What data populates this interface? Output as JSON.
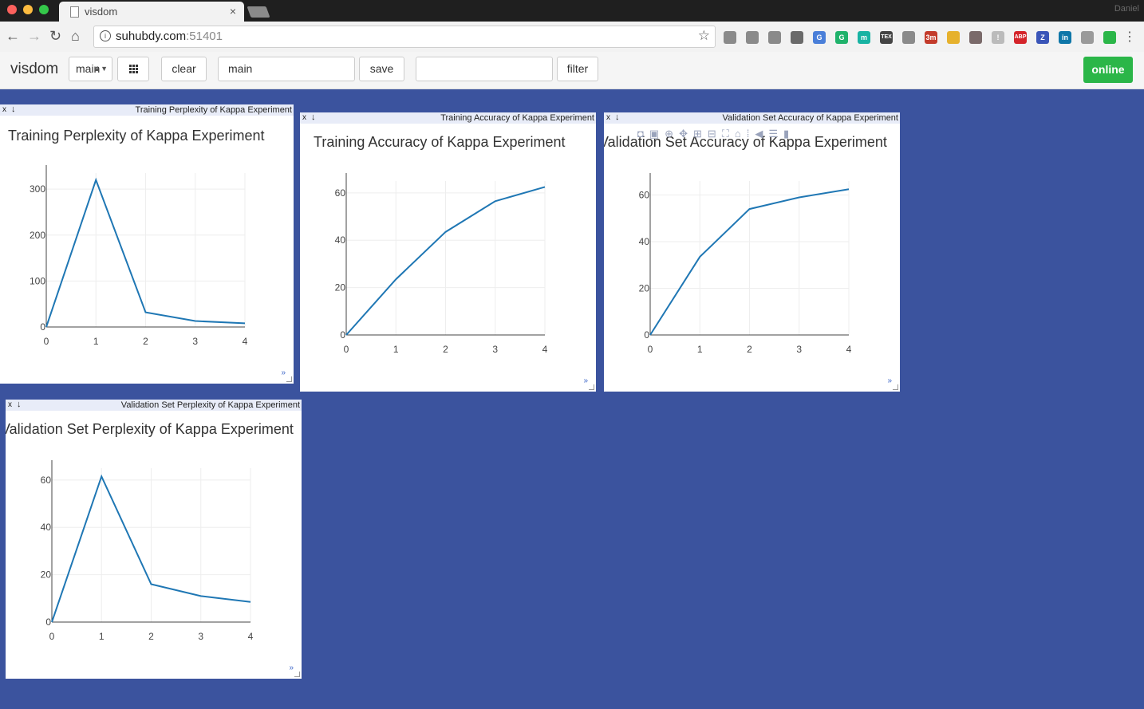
{
  "browser": {
    "tab_title": "visdom",
    "tab_close": "×",
    "profile_name": "Daniel",
    "url_host": "suhubdy.com",
    "url_port": ":51401",
    "menu_icon": "⋮"
  },
  "extensions": [
    {
      "name": "docs-icon",
      "color": "#8a8a8a",
      "text": ""
    },
    {
      "name": "drive-icon",
      "color": "#8a8a8a",
      "text": ""
    },
    {
      "name": "pocket-icon",
      "color": "#8a8a8a",
      "text": ""
    },
    {
      "name": "dropbox-icon",
      "color": "#6a6a6a",
      "text": ""
    },
    {
      "name": "translate-icon",
      "color": "#4a7fd9",
      "text": "G"
    },
    {
      "name": "grammarly-icon",
      "color": "#20b26b",
      "text": "G"
    },
    {
      "name": "mendeley-icon",
      "color": "#18b3a3",
      "text": "m"
    },
    {
      "name": "tex-icon",
      "color": "#444444",
      "text": "TEX"
    },
    {
      "name": "note-icon",
      "color": "#8a8a8a",
      "text": ""
    },
    {
      "name": "timer-icon",
      "color": "#c33b2b",
      "text": "3m"
    },
    {
      "name": "emoji-icon",
      "color": "#e6b12d",
      "text": ""
    },
    {
      "name": "avatar-icon",
      "color": "#7a6a6a",
      "text": ""
    },
    {
      "name": "alert-icon",
      "color": "#bbbbbb",
      "text": "!"
    },
    {
      "name": "adblock-icon",
      "color": "#d4242a",
      "text": "ABP"
    },
    {
      "name": "zotero-icon",
      "color": "#3a55b8",
      "text": "Z"
    },
    {
      "name": "linkedin-icon",
      "color": "#0e76a8",
      "text": "in"
    },
    {
      "name": "settings-ext-icon",
      "color": "#9a9a9a",
      "text": ""
    },
    {
      "name": "shield-ext-icon",
      "color": "#2bb648",
      "text": ""
    }
  ],
  "toolbar": {
    "brand": "visdom",
    "env_select": "main",
    "clear_label": "clear",
    "env_name_value": "main",
    "save_label": "save",
    "filter_value": "",
    "filter_label": "filter",
    "status_label": "online"
  },
  "panes": [
    {
      "window_title": "Training Perplexity of Kappa Experiment",
      "plot_title": "Training Perplexity of Kappa Experiment",
      "chart_data": {
        "type": "line",
        "x": [
          0,
          1,
          2,
          3,
          4
        ],
        "y": [
          0,
          320,
          32,
          13,
          8
        ],
        "xlim": [
          0,
          4
        ],
        "ylim": [
          0,
          335
        ],
        "yticks": [
          0,
          100,
          200,
          300
        ],
        "xticks": [
          0,
          1,
          2,
          3,
          4
        ],
        "grid": true,
        "color": "#1f77b4"
      }
    },
    {
      "window_title": "Training Accuracy of Kappa Experiment",
      "plot_title": "Training Accuracy of Kappa Experiment",
      "chart_data": {
        "type": "line",
        "x": [
          0,
          1,
          2,
          3,
          4
        ],
        "y": [
          0,
          23.5,
          43.5,
          56.5,
          62.5
        ],
        "xlim": [
          0,
          4
        ],
        "ylim": [
          0,
          65
        ],
        "yticks": [
          0,
          20,
          40,
          60
        ],
        "xticks": [
          0,
          1,
          2,
          3,
          4
        ],
        "grid": true,
        "color": "#1f77b4"
      }
    },
    {
      "window_title": "Validation Set Accuracy of Kappa Experiment",
      "plot_title": "Validation Set Accuracy of Kappa Experiment",
      "chart_data": {
        "type": "line",
        "x": [
          0,
          1,
          2,
          3,
          4
        ],
        "y": [
          0,
          33.5,
          54,
          59,
          62.5
        ],
        "xlim": [
          0,
          4
        ],
        "ylim": [
          0,
          66
        ],
        "yticks": [
          0,
          20,
          40,
          60
        ],
        "xticks": [
          0,
          1,
          2,
          3,
          4
        ],
        "grid": true,
        "color": "#1f77b4"
      }
    },
    {
      "window_title": "Validation Set Perplexity of Kappa Experiment",
      "plot_title": "Validation Set Perplexity of Kappa Experiment",
      "chart_data": {
        "type": "line",
        "x": [
          0,
          1,
          2,
          3,
          4
        ],
        "y": [
          0,
          61.5,
          16,
          11,
          8.5
        ],
        "xlim": [
          0,
          4
        ],
        "ylim": [
          0,
          65
        ],
        "yticks": [
          0,
          20,
          40,
          60
        ],
        "xticks": [
          0,
          1,
          2,
          3,
          4
        ],
        "grid": true,
        "color": "#1f77b4"
      }
    }
  ],
  "chart_data": [
    {
      "type": "line",
      "title": "Training Perplexity of Kappa Experiment",
      "x": [
        0,
        1,
        2,
        3,
        4
      ],
      "y": [
        0,
        320,
        32,
        13,
        8
      ]
    },
    {
      "type": "line",
      "title": "Training Accuracy of Kappa Experiment",
      "x": [
        0,
        1,
        2,
        3,
        4
      ],
      "y": [
        0,
        23.5,
        43.5,
        56.5,
        62.5
      ]
    },
    {
      "type": "line",
      "title": "Validation Set Accuracy of Kappa Experiment",
      "x": [
        0,
        1,
        2,
        3,
        4
      ],
      "y": [
        0,
        33.5,
        54,
        59,
        62.5
      ]
    },
    {
      "type": "line",
      "title": "Validation Set Perplexity of Kappa Experiment",
      "x": [
        0,
        1,
        2,
        3,
        4
      ],
      "y": [
        0,
        61.5,
        16,
        11,
        8.5
      ]
    }
  ]
}
